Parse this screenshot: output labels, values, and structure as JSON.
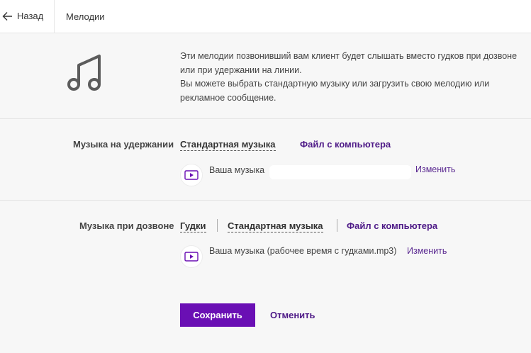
{
  "header": {
    "back_label": "Назад",
    "breadcrumb": "Мелодии"
  },
  "intro": {
    "lines": [
      "Эти мелодии позвонивший вам клиент будет слышать вместо гудков при дозвоне",
      "или при удержании на линии.",
      "Вы можете выбрать стандартную музыку или загрузить свою мелодию или",
      "рекламное сообщение."
    ]
  },
  "hold": {
    "label": "Музыка на удержании",
    "option_standard": "Стандартная музыка",
    "option_file": "Файл с компьютера",
    "music_prefix": "Ваша музыка",
    "change": "Изменить"
  },
  "ring": {
    "label": "Музыка при дозвоне",
    "option_beeps": "Гудки",
    "option_standard": "Стандартная музыка",
    "option_file": "Файл с компьютера",
    "music_text": "Ваша музыка (рабочее время с гудками.mp3)",
    "change": "Изменить"
  },
  "actions": {
    "save": "Сохранить",
    "cancel": "Отменить"
  },
  "colors": {
    "accent": "#6a0fb4",
    "link": "#4e1a87",
    "icon": "#5c5c5c"
  }
}
